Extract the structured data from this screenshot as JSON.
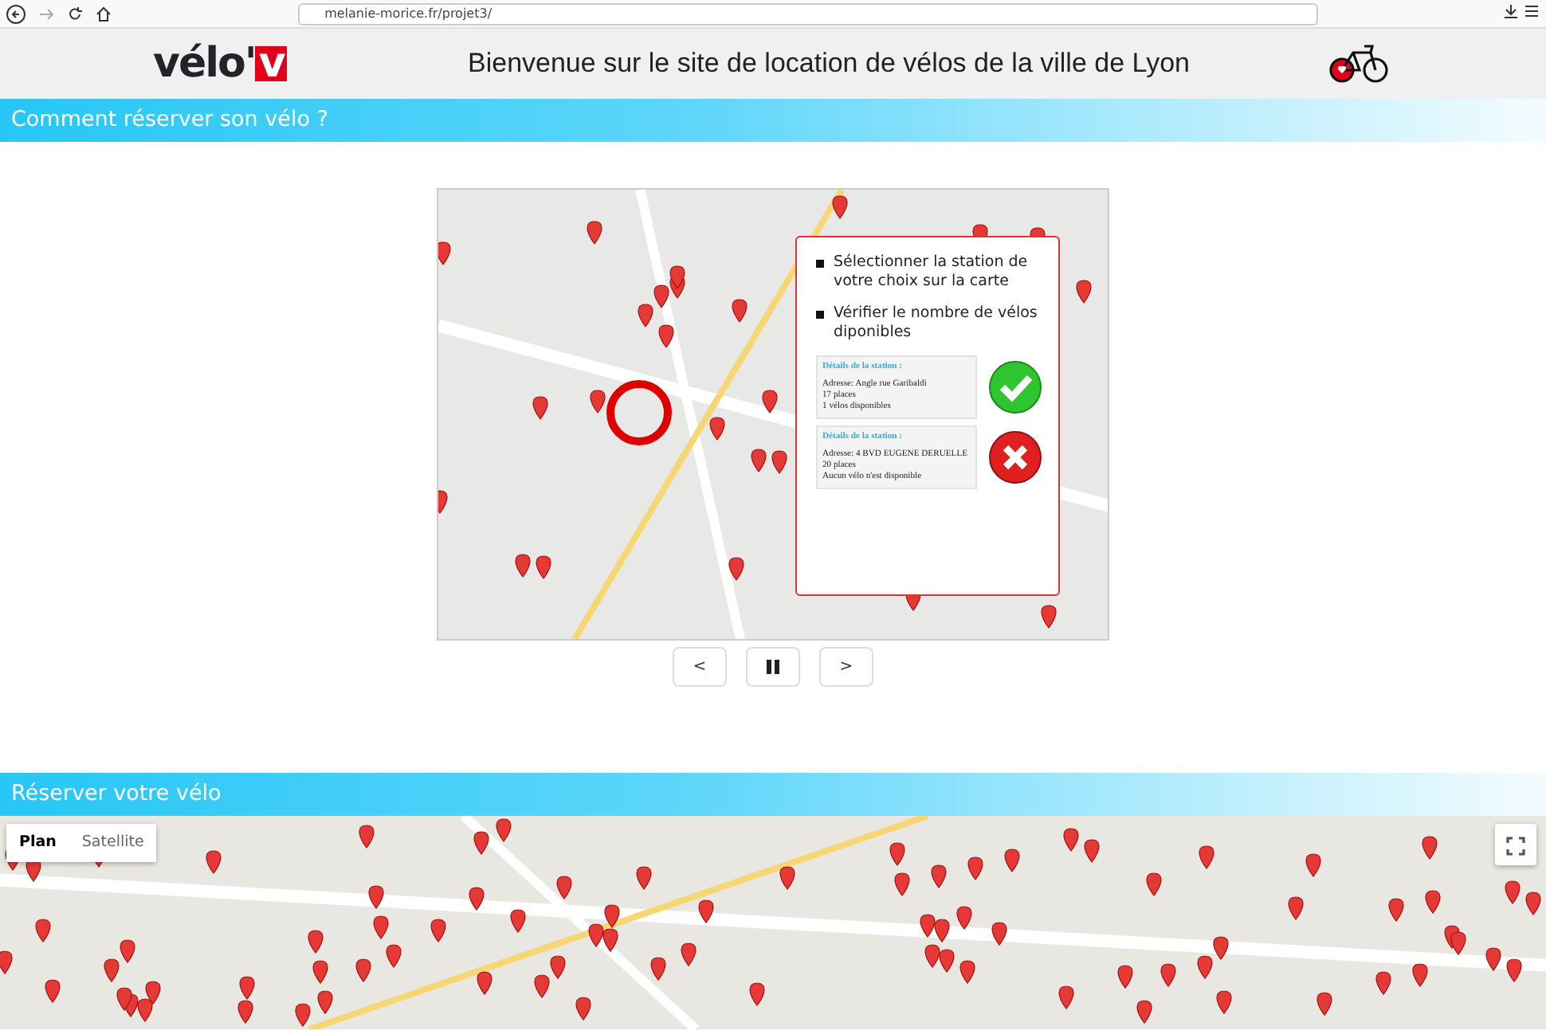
{
  "browser": {
    "url": "melanie-morice.fr/projet3/"
  },
  "header": {
    "logo_main": "vélo'",
    "logo_accent": "v",
    "title": "Bienvenue sur le site de location de vélos de la ville de Lyon"
  },
  "section_1": {
    "title": "Comment réserver son vélo ?"
  },
  "slide": {
    "steps": [
      "Sélectionner la station de votre choix sur la carte",
      "Vérifier le nombre de vélos diponibles"
    ],
    "examples": [
      {
        "kind": "ok",
        "heading": "Détails de la station :",
        "lines": [
          "Adresse: Angle rue Garibaldi",
          "17 places",
          "1 vélos disponibles"
        ]
      },
      {
        "kind": "ko",
        "heading": "Détails de la station :",
        "lines": [
          "Adresse: 4 BVD EUGENE DERUELLE",
          "20 places",
          "Aucun vélo n'est disponible"
        ]
      }
    ]
  },
  "carousel_controls": [
    {
      "kind": "prev",
      "label": "<"
    },
    {
      "kind": "pause"
    },
    {
      "kind": "next",
      "label": ">"
    }
  ],
  "section_2": {
    "title": "Réserver votre vélo"
  },
  "map": {
    "tabs": [
      {
        "label": "Plan",
        "selected": true
      },
      {
        "label": "Satellite",
        "selected": false
      }
    ]
  }
}
